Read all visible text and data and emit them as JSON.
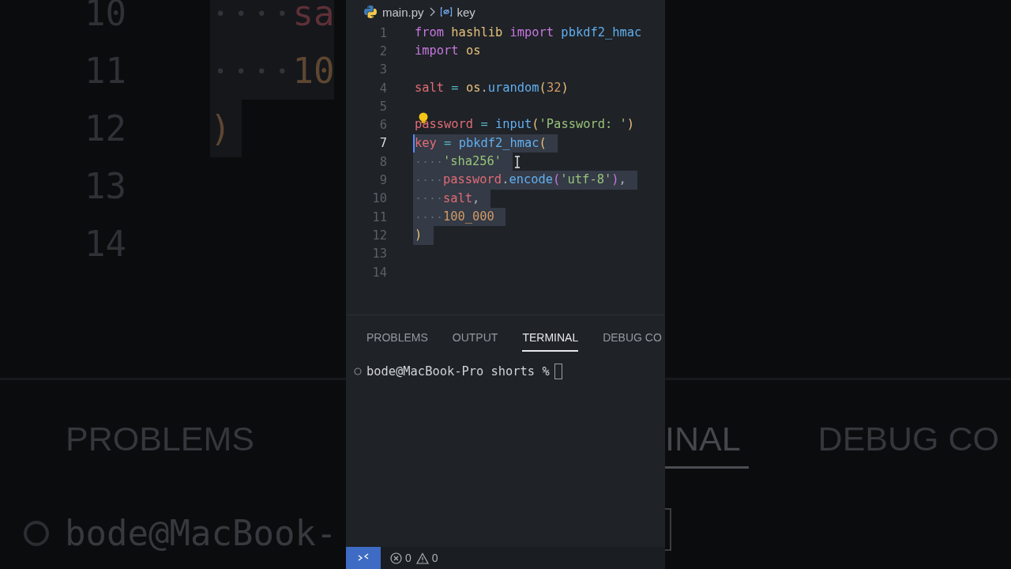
{
  "backdrop": {
    "left": {
      "lines": [
        {
          "number": "10",
          "selected": true,
          "indented": true,
          "tokens": [
            {
              "text": "sa",
              "kind": "variable"
            }
          ]
        },
        {
          "number": "11",
          "selected": true,
          "indented": true,
          "tokens": [
            {
              "text": "10",
              "kind": "number"
            }
          ]
        },
        {
          "number": "12",
          "selected": true,
          "tokens": [
            {
              "text": ")",
              "kind": "bracket"
            }
          ]
        },
        {
          "number": "13"
        },
        {
          "number": "14"
        }
      ],
      "tabs": [
        {
          "label": "PROBLEMS",
          "selected": false
        }
      ],
      "terminal_prompt": "bode@MacBook-"
    },
    "right": {
      "tabs": [
        {
          "label": "INAL",
          "selected": true
        },
        {
          "label": "DEBUG CO",
          "selected": false
        }
      ]
    }
  },
  "editor": {
    "breadcrumb": {
      "file": "main.py",
      "symbol": "key"
    },
    "lines": [
      {
        "number": "1",
        "selected": false,
        "current": false,
        "tokens": [
          {
            "text": "from ",
            "kind": "keyword"
          },
          {
            "text": "hashlib ",
            "kind": "module"
          },
          {
            "text": "import ",
            "kind": "keyword"
          },
          {
            "text": "pbkdf2_hmac",
            "kind": "function"
          }
        ]
      },
      {
        "number": "2",
        "selected": false,
        "current": false,
        "tokens": [
          {
            "text": "import ",
            "kind": "keyword"
          },
          {
            "text": "os",
            "kind": "module"
          }
        ]
      },
      {
        "number": "3",
        "selected": false,
        "current": false
      },
      {
        "number": "4",
        "selected": false,
        "current": false,
        "tokens": [
          {
            "text": "salt",
            "kind": "variable"
          },
          {
            "text": " = ",
            "kind": "operator"
          },
          {
            "text": "os",
            "kind": "module"
          },
          {
            "text": ".",
            "kind": "plain"
          },
          {
            "text": "urandom",
            "kind": "function"
          },
          {
            "text": "(",
            "kind": "bracket"
          },
          {
            "text": "32",
            "kind": "number"
          },
          {
            "text": ")",
            "kind": "bracket"
          }
        ]
      },
      {
        "number": "5",
        "selected": false,
        "current": false
      },
      {
        "number": "6",
        "selected": false,
        "current": false,
        "bulb": true,
        "tokens": [
          {
            "text": "password",
            "kind": "variable"
          },
          {
            "text": " = ",
            "kind": "operator"
          },
          {
            "text": "input",
            "kind": "function"
          },
          {
            "text": "(",
            "kind": "bracket"
          },
          {
            "text": "'Password: '",
            "kind": "string"
          },
          {
            "text": ")",
            "kind": "bracket"
          }
        ]
      },
      {
        "number": "7",
        "selected": true,
        "current": true,
        "tokens": [
          {
            "text": "key",
            "kind": "variable"
          },
          {
            "text": " = ",
            "kind": "operator"
          },
          {
            "text": "pbkdf2_hmac",
            "kind": "function"
          },
          {
            "text": "(",
            "kind": "bracket"
          }
        ]
      },
      {
        "number": "8",
        "selected": true,
        "current": false,
        "indented": true,
        "tokens": [
          {
            "text": "'sha256'",
            "kind": "string"
          }
        ]
      },
      {
        "number": "9",
        "selected": true,
        "current": false,
        "indented": true,
        "tokens": [
          {
            "text": "password",
            "kind": "variable"
          },
          {
            "text": ".",
            "kind": "plain"
          },
          {
            "text": "encode",
            "kind": "function"
          },
          {
            "text": "(",
            "kind": "bracket2"
          },
          {
            "text": "'utf-8'",
            "kind": "string"
          },
          {
            "text": ")",
            "kind": "bracket2"
          },
          {
            "text": ",",
            "kind": "plain"
          }
        ]
      },
      {
        "number": "10",
        "selected": true,
        "current": false,
        "indented": true,
        "tokens": [
          {
            "text": "salt",
            "kind": "variable"
          },
          {
            "text": ",",
            "kind": "plain"
          }
        ]
      },
      {
        "number": "11",
        "selected": true,
        "current": false,
        "indented": true,
        "tokens": [
          {
            "text": "100_000",
            "kind": "number"
          }
        ]
      },
      {
        "number": "12",
        "selected": true,
        "current": false,
        "tokens": [
          {
            "text": ")",
            "kind": "bracket"
          }
        ]
      },
      {
        "number": "13",
        "selected": false,
        "current": false
      },
      {
        "number": "14",
        "selected": false,
        "current": false
      }
    ]
  },
  "panel": {
    "tabs": [
      {
        "label": "PROBLEMS",
        "selected": false
      },
      {
        "label": "OUTPUT",
        "selected": false
      },
      {
        "label": "TERMINAL",
        "selected": true
      },
      {
        "label": "DEBUG CO",
        "selected": false
      }
    ],
    "terminal": {
      "prompt": "bode@MacBook-Pro shorts %"
    }
  },
  "status_bar": {
    "errors": "0",
    "warnings": "0"
  }
}
